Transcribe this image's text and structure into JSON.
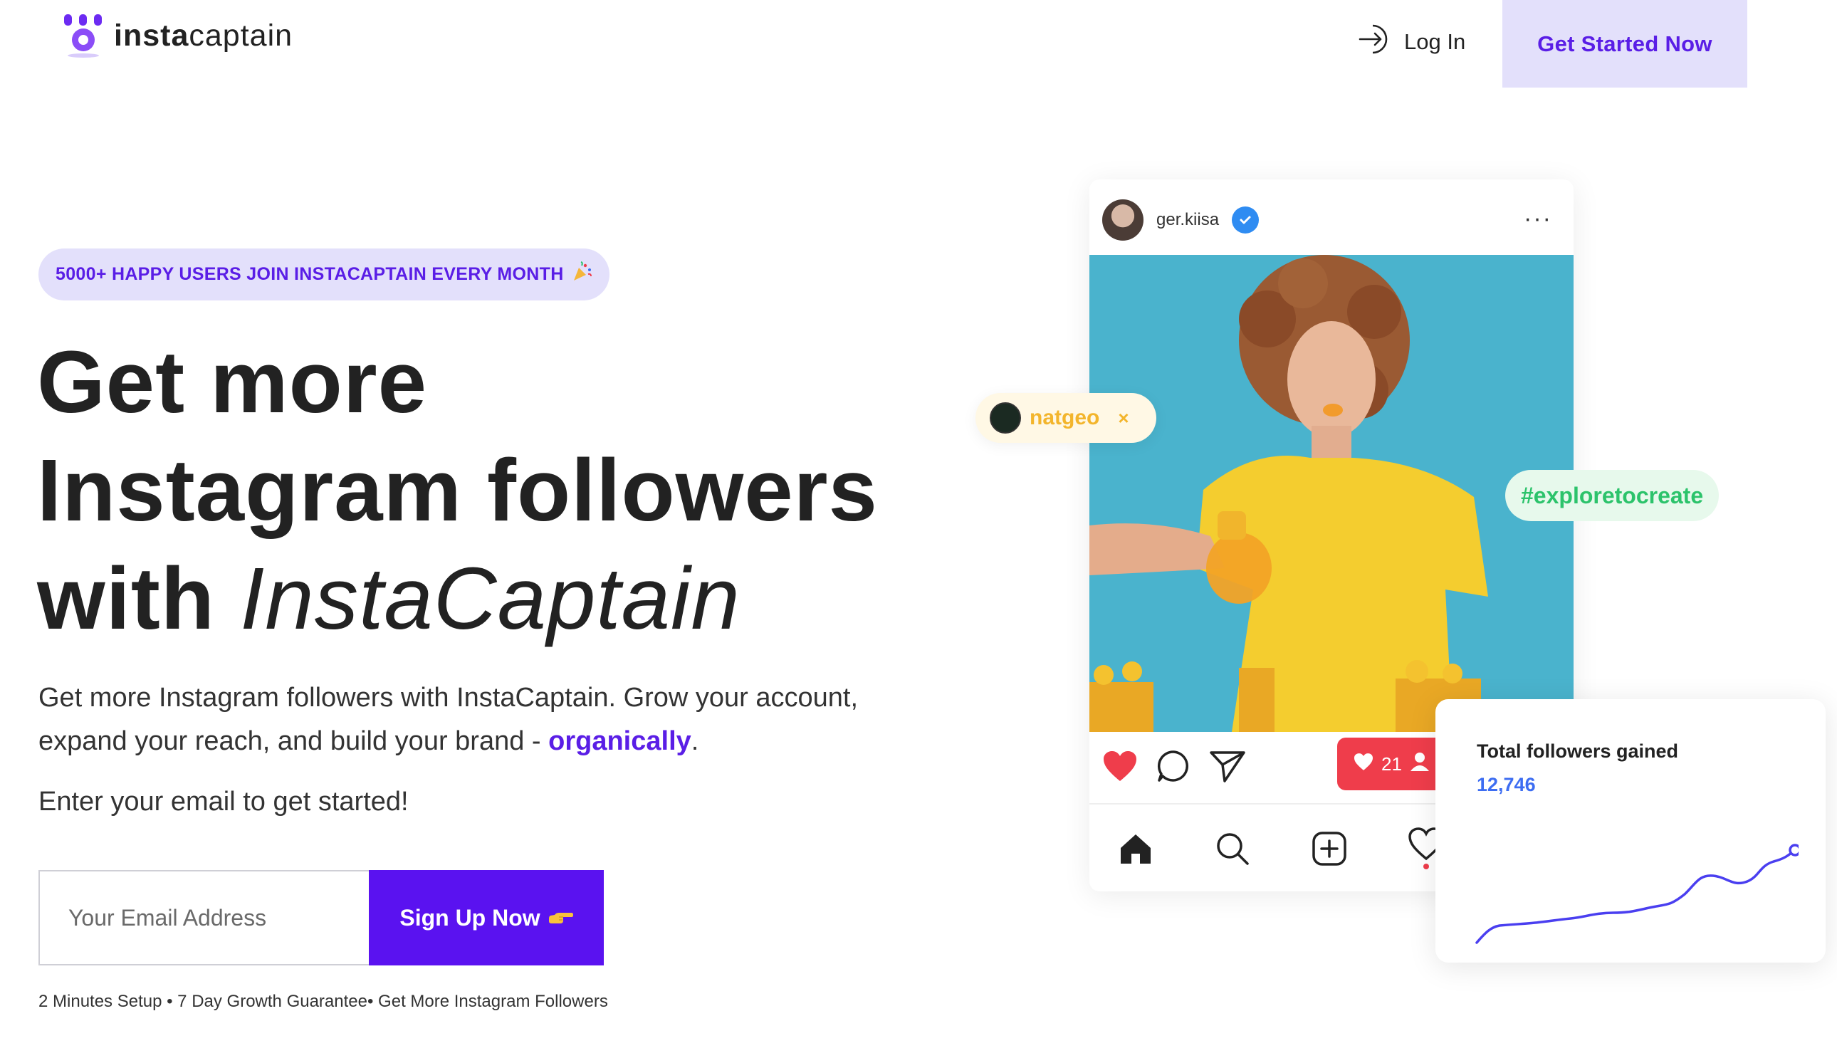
{
  "nav": {
    "logo_text_bold": "insta",
    "logo_text_light": "captain",
    "login_label": "Log In",
    "cta_label": "Get Started Now"
  },
  "hero": {
    "badge_text": "5000+ HAPPY USERS JOIN INSTACAPTAIN EVERY MONTH",
    "headline_line1": "Get more",
    "headline_line2": "Instagram followers",
    "headline_line3_plain": "with ",
    "headline_line3_italic": "InstaCaptain",
    "subtext_main": "Get more Instagram followers with InstaCaptain. Grow your account, expand your reach, and build your brand - ",
    "subtext_highlight": "organically",
    "subtext_end": ".",
    "email_prompt": "Enter your email to get started!",
    "email_placeholder": "Your Email Address",
    "signup_label": "Sign Up Now",
    "footnote": "2 Minutes Setup • 7 Day Growth Guarantee• Get More Instagram Followers"
  },
  "post": {
    "username": "ger.kiisa",
    "more_glyph": "···",
    "likes_count": "21"
  },
  "tags": {
    "natgeo_label": "natgeo",
    "natgeo_close": "×",
    "explore_label": "#exploretocreate"
  },
  "stats": {
    "title": "Total followers gained",
    "value": "12,746"
  },
  "colors": {
    "accent": "#5a12f0",
    "accent_light": "#e3e0fb",
    "like_red": "#ef3d4b",
    "stat_blue": "#3d6df2",
    "tag_green": "#2cc36b",
    "tag_yellow": "#f3b52c"
  }
}
